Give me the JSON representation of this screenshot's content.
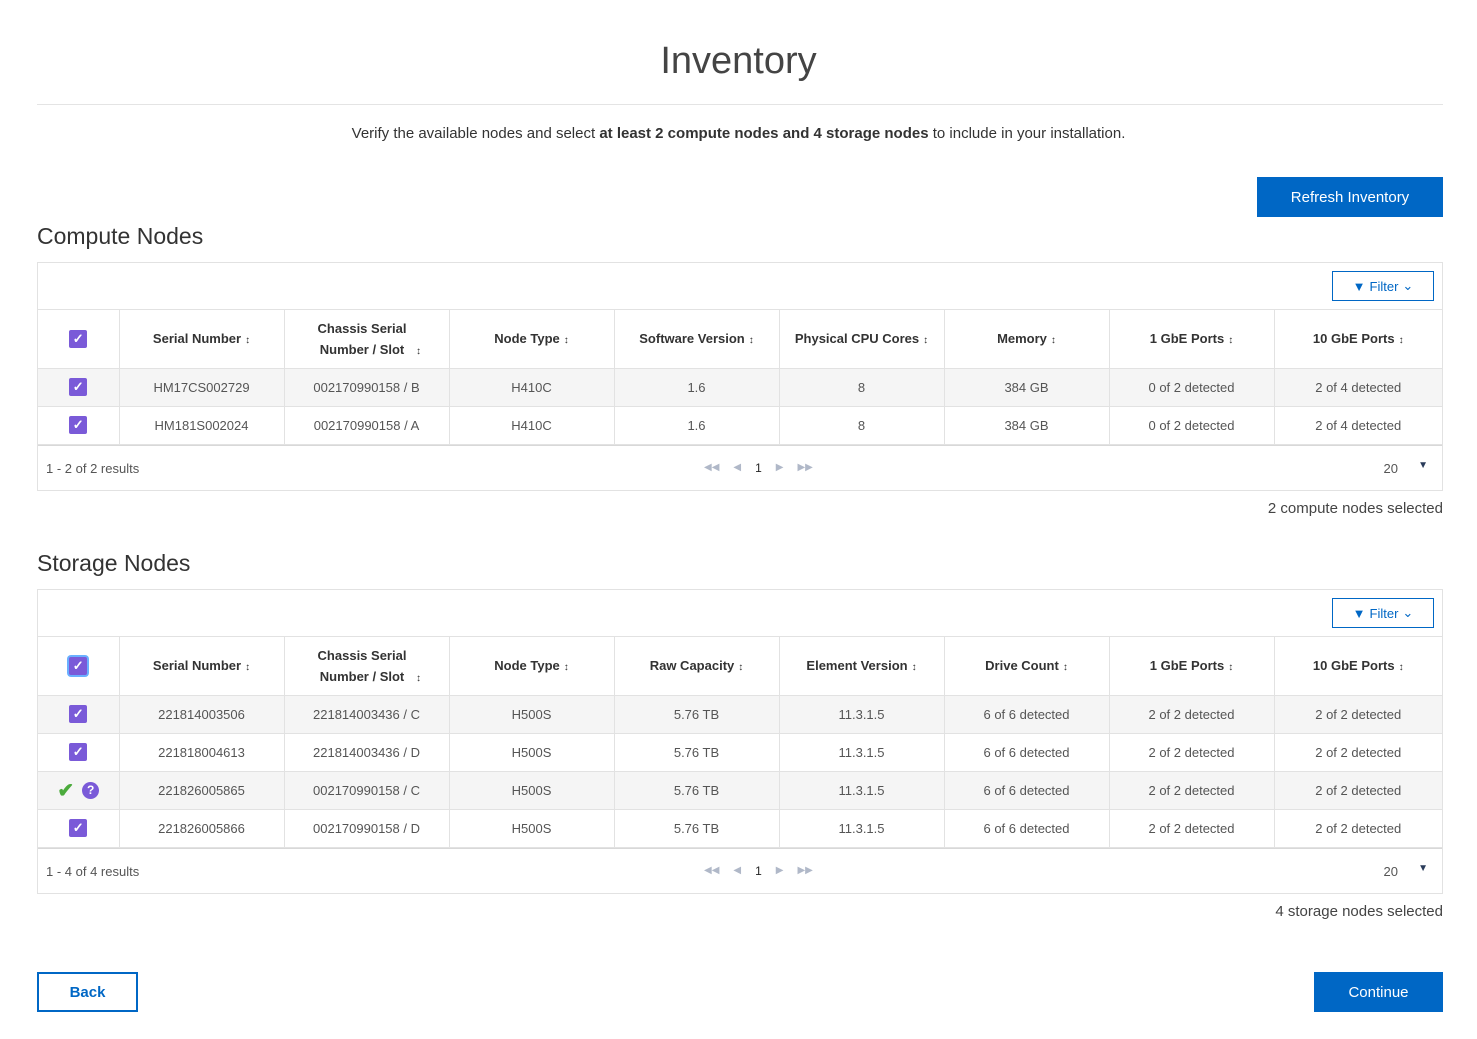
{
  "page": {
    "title": "Inventory",
    "intro_pre": "Verify the available nodes and select ",
    "intro_bold": "at least 2 compute nodes and 4 storage nodes",
    "intro_post": " to include in your installation.",
    "refresh": "Refresh Inventory",
    "back": "Back",
    "continue": "Continue"
  },
  "compute": {
    "title": "Compute Nodes",
    "filter": "Filter",
    "headers": [
      "Serial Number",
      "Chassis Serial Number / Slot",
      "Node Type",
      "Software Version",
      "Physical CPU Cores",
      "Memory",
      "1 GbE Ports",
      "10 GbE Ports"
    ],
    "rows": [
      {
        "state": "checked",
        "cells": [
          "HM17CS002729",
          "002170990158 / B",
          "H410C",
          "1.6",
          "8",
          "384 GB",
          "0 of 2 detected",
          "2 of 4 detected"
        ]
      },
      {
        "state": "checked",
        "cells": [
          "HM181S002024",
          "002170990158 / A",
          "H410C",
          "1.6",
          "8",
          "384 GB",
          "0 of 2 detected",
          "2 of 4 detected"
        ]
      }
    ],
    "results": "1 - 2 of 2 results",
    "page": "1",
    "page_size": "20",
    "selected": "2 compute nodes selected"
  },
  "storage": {
    "title": "Storage Nodes",
    "filter": "Filter",
    "headers": [
      "Serial Number",
      "Chassis Serial Number / Slot",
      "Node Type",
      "Raw Capacity",
      "Element Version",
      "Drive Count",
      "1 GbE Ports",
      "10 GbE Ports"
    ],
    "rows": [
      {
        "state": "checked",
        "cells": [
          "221814003506",
          "221814003436 / C",
          "H500S",
          "5.76 TB",
          "11.3.1.5",
          "6 of 6 detected",
          "2 of 2 detected",
          "2 of 2 detected"
        ]
      },
      {
        "state": "checked",
        "cells": [
          "221818004613",
          "221814003436 / D",
          "H500S",
          "5.76 TB",
          "11.3.1.5",
          "6 of 6 detected",
          "2 of 2 detected",
          "2 of 2 detected"
        ]
      },
      {
        "state": "verified",
        "cells": [
          "221826005865",
          "002170990158 / C",
          "H500S",
          "5.76 TB",
          "11.3.1.5",
          "6 of 6 detected",
          "2 of 2 detected",
          "2 of 2 detected"
        ]
      },
      {
        "state": "checked",
        "cells": [
          "221826005866",
          "002170990158 / D",
          "H500S",
          "5.76 TB",
          "11.3.1.5",
          "6 of 6 detected",
          "2 of 2 detected",
          "2 of 2 detected"
        ]
      }
    ],
    "results": "1 - 4 of 4 results",
    "page": "1",
    "page_size": "20",
    "selected": "4 storage nodes selected"
  }
}
